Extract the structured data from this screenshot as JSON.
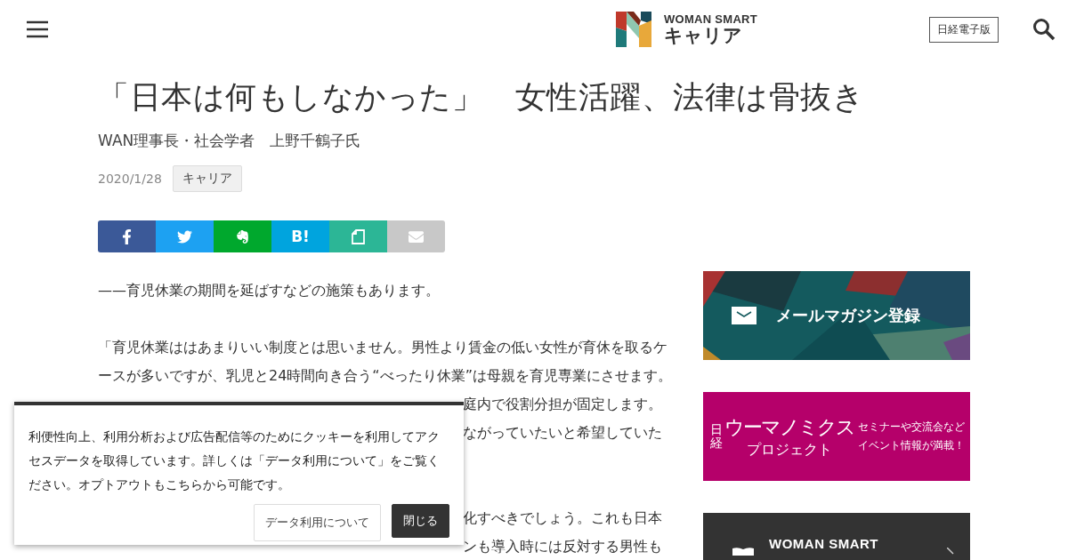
{
  "header": {
    "logo": {
      "line1": "WOMAN SMART",
      "line2": "キャリア"
    },
    "edition_button": "日経電子版"
  },
  "article": {
    "title": "「日本は何もしなかった」　女性活躍、法律は骨抜き",
    "byline": "WAN理事長・社会学者　上野千鶴子氏",
    "date": "2020/1/28",
    "category": "キャリア",
    "share_buttons": [
      {
        "kind": "facebook",
        "color": "#3b5998"
      },
      {
        "kind": "twitter",
        "color": "#1da1f2"
      },
      {
        "kind": "evernote",
        "color": "#00a82d"
      },
      {
        "kind": "hatena",
        "color": "#00a4de",
        "label": "B!"
      },
      {
        "kind": "note",
        "color": "#2cb696"
      },
      {
        "kind": "mail",
        "color": "#c8c8c8"
      }
    ],
    "body": [
      {
        "kind": "full",
        "text": "——育児休業の期間を延ばすなどの施策もあります。"
      },
      {
        "kind": "blank"
      },
      {
        "kind": "full",
        "text": "「育児休業ははあまりいい制度とは思いません。男性より賃金の低い女性が育休を取るケ"
      },
      {
        "kind": "full",
        "text": "ースが多いですが、乳児と24時間向き合う“べったり休業”は母親を育児専業にさせます。"
      },
      {
        "kind": "tail",
        "text": "庭内で役割分担が固定します。"
      },
      {
        "kind": "tail",
        "text": "ながっていたいと希望していた"
      },
      {
        "kind": "blank"
      },
      {
        "kind": "blank"
      },
      {
        "kind": "tail",
        "text": "化すべきでしょう。これも日本"
      },
      {
        "kind": "tail",
        "text": "ンも導入時には反対する男性も"
      }
    ]
  },
  "sidebar": [
    {
      "kind": "mail",
      "text": "メールマガジン登録"
    },
    {
      "kind": "womanomics",
      "small": "日経",
      "big": "ウーマノミクス",
      "sub": "プロジェクト",
      "note1": "セミナーや交流会など",
      "note2": "イベント情報が満載！"
    },
    {
      "kind": "woman-smart",
      "text": "WOMAN SMART"
    }
  ],
  "cookie": {
    "text": "利便性向上、利用分析および広告配信等のためにクッキーを利用してアクセスデータを取得しています。詳しくは「データ利用について」をご覧ください。オプトアウトもこちらから可能です。",
    "buttons": [
      {
        "kind": "secondary",
        "label": "データ利用について"
      },
      {
        "kind": "primary",
        "label": "閉じる"
      }
    ]
  }
}
